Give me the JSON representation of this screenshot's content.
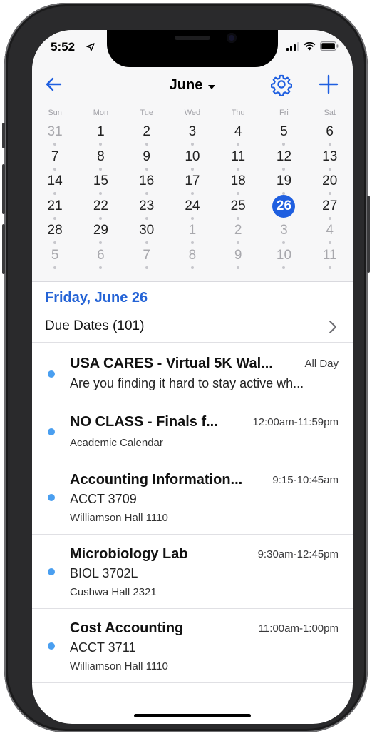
{
  "status_bar": {
    "time": "5:52"
  },
  "nav": {
    "month_label": "June"
  },
  "calendar": {
    "weekdays": [
      "Sun",
      "Mon",
      "Tue",
      "Wed",
      "Thu",
      "Fri",
      "Sat"
    ],
    "weeks": [
      [
        "31",
        "1",
        "2",
        "3",
        "4",
        "5",
        "6"
      ],
      [
        "7",
        "8",
        "9",
        "10",
        "11",
        "12",
        "13"
      ],
      [
        "14",
        "15",
        "16",
        "17",
        "18",
        "19",
        "20"
      ],
      [
        "21",
        "22",
        "23",
        "24",
        "25",
        "26",
        "27"
      ],
      [
        "28",
        "29",
        "30",
        "1",
        "2",
        "3",
        "4"
      ],
      [
        "5",
        "6",
        "7",
        "8",
        "9",
        "10",
        "11"
      ]
    ],
    "selected_day": "26"
  },
  "day_view": {
    "date_heading": "Friday, June 26",
    "due_dates_label": "Due Dates (101)"
  },
  "events": [
    {
      "title": "USA CARES - Virtual 5K Wal...",
      "time": "All Day",
      "subtitle": "Are you finding it hard to stay active wh...",
      "detail": ""
    },
    {
      "title": "NO CLASS - Finals f...",
      "time": "12:00am-11:59pm",
      "subtitle": "",
      "detail": "Academic Calendar"
    },
    {
      "title": "Accounting Information...",
      "time": "9:15-10:45am",
      "subtitle": "ACCT 3709",
      "detail": "Williamson Hall 1110"
    },
    {
      "title": "Microbiology Lab",
      "time": "9:30am-12:45pm",
      "subtitle": "BIOL 3702L",
      "detail": "Cushwa Hall 2321"
    },
    {
      "title": "Cost Accounting",
      "time": "11:00am-1:00pm",
      "subtitle": "ACCT 3711",
      "detail": "Williamson Hall 1110"
    }
  ],
  "colors": {
    "accent": "#1f5fe0",
    "event_dot": "#4a9ff0",
    "date_heading": "#2463d6"
  }
}
